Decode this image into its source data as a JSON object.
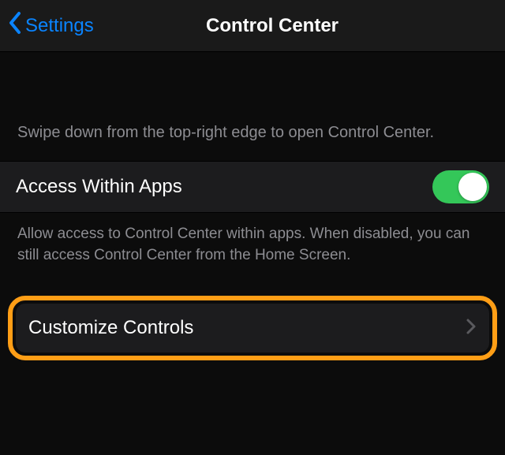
{
  "nav": {
    "back_label": "Settings",
    "title": "Control Center"
  },
  "intro_text": "Swipe down from the top-right edge to open Control Center.",
  "access_row": {
    "label": "Access Within Apps",
    "toggle_on": true
  },
  "access_footer": "Allow access to Control Center within apps. When disabled, you can still access Control Center from the Home Screen.",
  "customize_row": {
    "label": "Customize Controls"
  },
  "colors": {
    "accent_blue": "#0a84ff",
    "toggle_green": "#34c759",
    "highlight_orange": "#ff9e16"
  }
}
